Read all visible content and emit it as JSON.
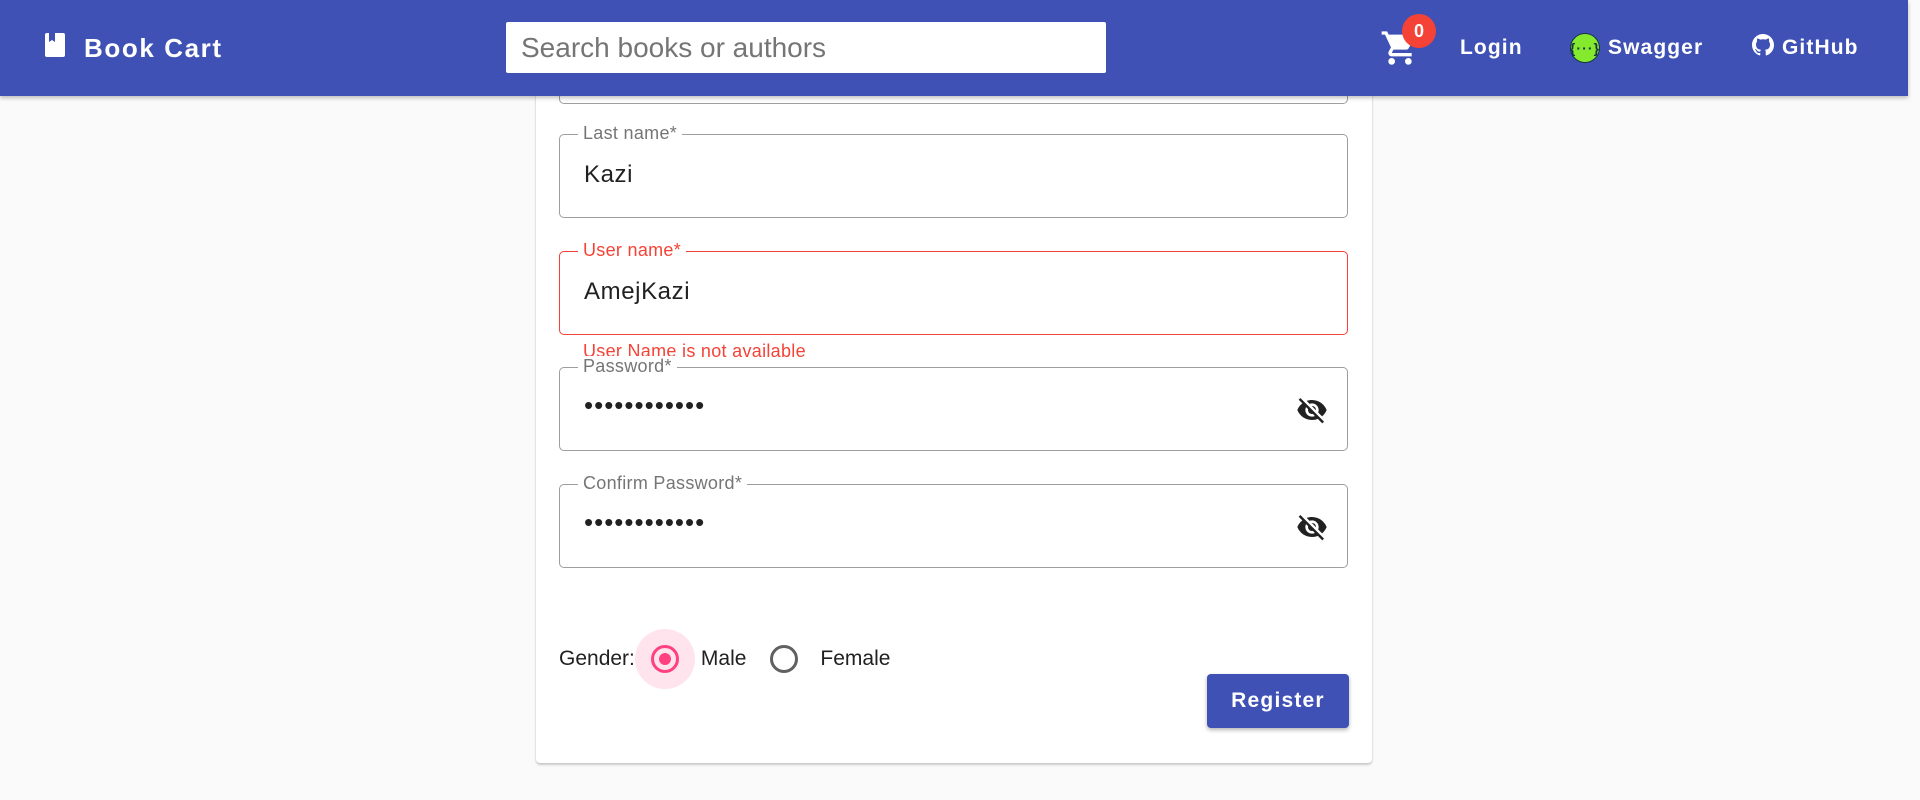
{
  "header": {
    "brand": "Book Cart",
    "search_placeholder": "Search books or authors",
    "cart_count": "0",
    "login_label": "Login",
    "swagger_label": "Swagger",
    "swagger_icon_text": "{···}",
    "github_label": "GitHub"
  },
  "form": {
    "last_name": {
      "label": "Last name*",
      "value": "Kazi"
    },
    "user_name": {
      "label": "User name*",
      "value": "AmejKazi",
      "error": "User Name is not available"
    },
    "password": {
      "label": "Password*",
      "value": "••••••••••••"
    },
    "confirm_password": {
      "label": "Confirm Password*",
      "value": "••••••••••••"
    },
    "gender": {
      "label": "Gender:",
      "options": [
        "Male",
        "Female"
      ],
      "selected": "Male"
    },
    "register_label": "Register"
  },
  "colors": {
    "primary": "#3f51b5",
    "accent": "#ff4081",
    "error": "#f44336",
    "swagger_green": "#85ea2d"
  }
}
